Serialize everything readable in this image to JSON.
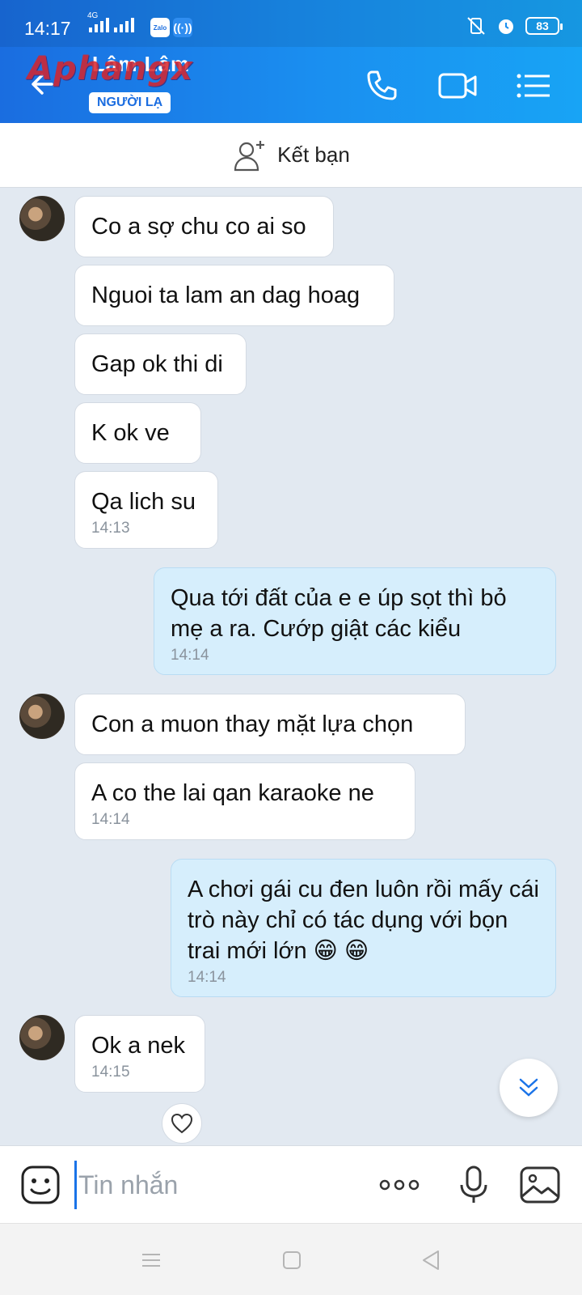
{
  "status_bar": {
    "time": "14:17",
    "network": "4G",
    "app_icon_label": "Zalo",
    "battery": "83"
  },
  "header": {
    "contact_name": "Lâm Lâm",
    "badge": "NGƯỜI LẠ",
    "watermark": "Aphangx",
    "icons": [
      "back-arrow-icon",
      "phone-icon",
      "video-call-icon",
      "menu-list-icon"
    ]
  },
  "add_friend": {
    "label": "Kết bạn"
  },
  "messages": [
    {
      "side": "in",
      "text": "Co a sợ chu co ai so",
      "time": ""
    },
    {
      "side": "in",
      "text": "Nguoi ta lam an dag hoag",
      "time": ""
    },
    {
      "side": "in",
      "text": "Gap ok thi di",
      "time": ""
    },
    {
      "side": "in",
      "text": "K ok ve",
      "time": ""
    },
    {
      "side": "in",
      "text": "Qa lich su",
      "time": "14:13"
    },
    {
      "side": "out",
      "text": "Qua tới đất của e e úp sọt thì bỏ mẹ a ra. Cướp giật các kiểu",
      "time": "14:14"
    },
    {
      "side": "in",
      "text": "Con a muon thay mặt lựa chọn",
      "time": ""
    },
    {
      "side": "in",
      "text": "A co the lai qan karaoke ne",
      "time": "14:14"
    },
    {
      "side": "out",
      "text": "A chơi gái cu đen luôn rồi mấy cái trò này chỉ có tác dụng với bọn trai mới lớn 😁 😁",
      "time": "14:14"
    },
    {
      "side": "in",
      "text": "Ok a nek",
      "time": "14:15"
    }
  ],
  "composer": {
    "placeholder": "Tin nhắn"
  },
  "colors": {
    "header_start": "#1a6de0",
    "header_end": "#18a4f5",
    "chat_bg": "#e2e9f1",
    "out_bubble": "#d6eefc",
    "in_bubble": "#ffffff"
  }
}
